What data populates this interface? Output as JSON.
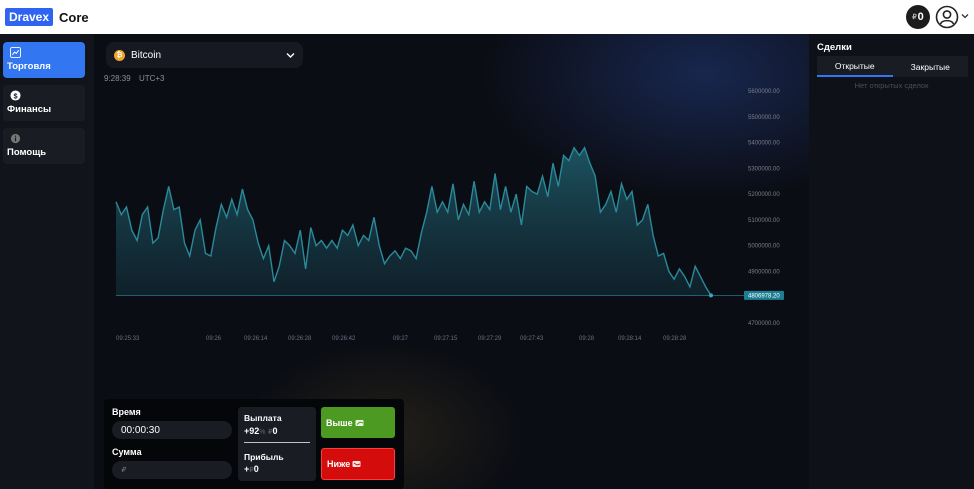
{
  "header": {
    "logo_badge": "Dravex",
    "logo_text": "Core",
    "balance_currency": "₽",
    "balance_value": "0"
  },
  "sidebar": {
    "items": [
      {
        "label": "Торговля",
        "icon": "chart-line-icon",
        "active": true
      },
      {
        "label": "Финансы",
        "icon": "dollar-icon",
        "active": false
      },
      {
        "label": "Помощь",
        "icon": "info-icon",
        "active": false
      }
    ]
  },
  "asset": {
    "name": "Bitcoin",
    "coin_glyph": "₿",
    "time": "9:28:39",
    "timezone": "UTC+3"
  },
  "chart_data": {
    "type": "area",
    "y_ticks": [
      "5600000.00",
      "5500000.00",
      "5400000.00",
      "5300000.00",
      "5200000.00",
      "5100000.00",
      "5000000.00",
      "4900000.00",
      "4700000.00"
    ],
    "y_tick_values": [
      5600000,
      5500000,
      5400000,
      5300000,
      5200000,
      5100000,
      5000000,
      4900000,
      4700000
    ],
    "ylim": [
      4700000,
      5600000
    ],
    "x_ticks": [
      "09:25:33",
      "09:26",
      "09:26:14",
      "09:26:28",
      "09:26:42",
      "09:27",
      "09:27:15",
      "09:27:29",
      "09:27:43",
      "09:28",
      "09:28:14",
      "09:28:28"
    ],
    "current_price": 4806978.2,
    "current_price_label": "4806978.20",
    "line_color": "#2a8a9a",
    "values": [
      5170000,
      5120000,
      5150000,
      5060000,
      5020000,
      5120000,
      5150000,
      5010000,
      5030000,
      5140000,
      5230000,
      5140000,
      5150000,
      5010000,
      4960000,
      5060000,
      5100000,
      4970000,
      4960000,
      5070000,
      5160000,
      5110000,
      5180000,
      5120000,
      5220000,
      5140000,
      5100000,
      5010000,
      4950000,
      5000000,
      4860000,
      4920000,
      5020000,
      5000000,
      4970000,
      5060000,
      4910000,
      5070000,
      5000000,
      5020000,
      4990000,
      5020000,
      4990000,
      5060000,
      5040000,
      5080000,
      5000000,
      5040000,
      5020000,
      5110000,
      5000000,
      4930000,
      4960000,
      4980000,
      4950000,
      4990000,
      4980000,
      4950000,
      5050000,
      5130000,
      5230000,
      5130000,
      5170000,
      5130000,
      5240000,
      5100000,
      5160000,
      5120000,
      5250000,
      5130000,
      5170000,
      5140000,
      5280000,
      5140000,
      5230000,
      5130000,
      5200000,
      5080000,
      5230000,
      5210000,
      5200000,
      5270000,
      5190000,
      5320000,
      5230000,
      5350000,
      5330000,
      5380000,
      5350000,
      5380000,
      5320000,
      5270000,
      5130000,
      5160000,
      5210000,
      5130000,
      5240000,
      5180000,
      5210000,
      5080000,
      5100000,
      5160000,
      5040000,
      4960000,
      4970000,
      4900000,
      4870000,
      4910000,
      4880000,
      4840000,
      4920000,
      4880000,
      4840000,
      4807000
    ]
  },
  "trade": {
    "time_label": "Время",
    "time_value": "00:00:30",
    "amount_label": "Сумма",
    "amount_placeholder": "₽",
    "payout_label": "Выплата",
    "payout_value": "+92",
    "payout_dim": "%",
    "payout_currency": "₽",
    "payout_tail": "0",
    "profit_label": "Прибыль",
    "profit_prefix": "+",
    "profit_currency": "₽",
    "profit_value": "0",
    "up_label": "Выше",
    "down_label": "Ниже",
    "up_color": "#4d9a22",
    "down_color": "#d40c0c"
  },
  "deals": {
    "title": "Сделки",
    "tab_open": "Открытые",
    "tab_closed": "Закрытые",
    "empty_text": "Нет открытых сделок"
  }
}
